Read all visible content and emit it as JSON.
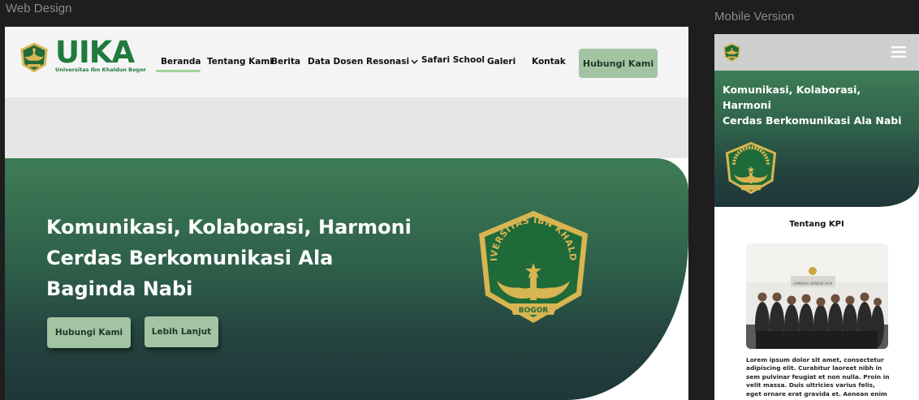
{
  "frames": {
    "web_label": "Web Design",
    "mobile_label": "Mobile Version"
  },
  "web": {
    "logo": {
      "wordmark": "UIKA",
      "subtitle": "Universitas Ibn Khaldun Bogor"
    },
    "nav": {
      "items": [
        {
          "label": "Beranda",
          "active": true
        },
        {
          "label": "Tentang Kami"
        },
        {
          "label": "Berita"
        },
        {
          "label": "Data Dosen"
        },
        {
          "label": "Resonasi",
          "has_dropdown": true
        },
        {
          "label": "Safari School"
        },
        {
          "label": "Galeri"
        },
        {
          "label": "Kontak"
        }
      ],
      "cta_label": "Hubungi Kami"
    },
    "hero": {
      "title_line1": "Komunikasi, Kolaborasi, Harmoni",
      "title_line2": "Cerdas Berkomunikasi Ala",
      "title_line3": "Baginda Nabi",
      "primary_button": "Hubungi Kami",
      "secondary_button": "Lebih Lanjut"
    },
    "emblem_text": {
      "top": "UNIVERSITAS IBN KHALDUN",
      "banner": "BOGOR"
    }
  },
  "mobile": {
    "hero": {
      "line1": "Komunikasi, Kolaborasi,",
      "line2": "Harmoni",
      "line3": "Cerdas Berkomunikasi Ala Nabi"
    },
    "section_title": "Tentang KPI",
    "body_text": "Lorem ipsum dolor sit amet, consectetur adipiscing elit. Curabitur laoreet nibh in sem pulvinar feugiat et non nulla. Proin in velit massa. Duis ultricies varius felis, eget ornare erat gravida et. Aenean enim urna,",
    "photo_sign": "LEMBAGA SENSOR FILM"
  },
  "colors": {
    "brand_green": "#1f7a3d",
    "hero_top": "#3e7d56",
    "hero_bottom": "#1f3639",
    "button_green": "#a3c4a3",
    "active_underline": "#9fd49a",
    "emblem_gold": "#d8b552"
  },
  "icons": {
    "nav_dropdown": "chevron-down-icon",
    "mobile_menu": "hamburger-menu-icon",
    "logo": "uika-emblem-icon"
  }
}
